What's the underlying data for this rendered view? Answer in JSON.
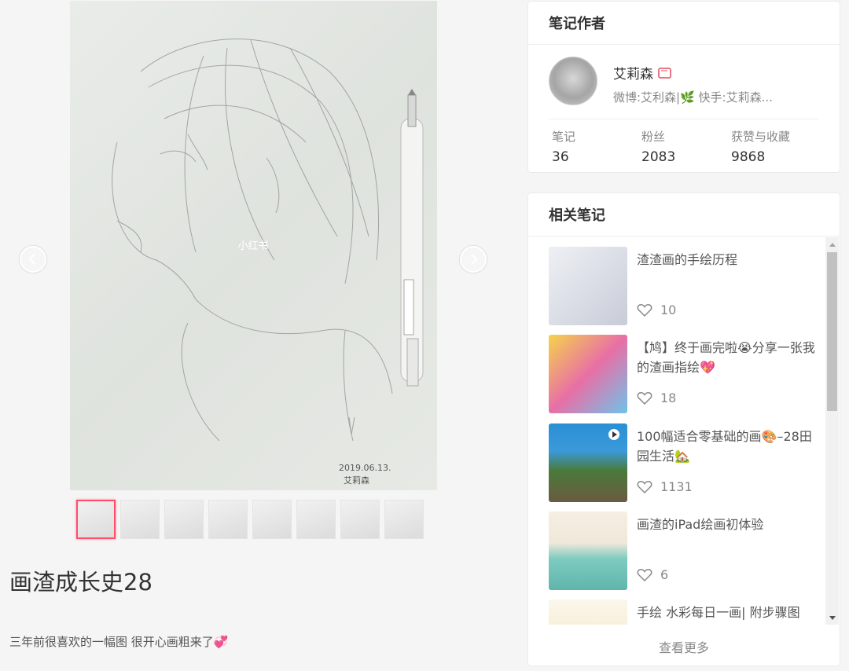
{
  "note": {
    "title": "画渣成长史28",
    "description": "三年前很喜欢的一幅图 很开心画粗来了💞",
    "image_watermark": "小红书",
    "image_date": "2019.06.13.",
    "image_signature": "艾莉森",
    "thumbnail_count": 8,
    "active_thumbnail": 1
  },
  "author_card": {
    "header": "笔记作者",
    "name": "艾莉森",
    "badge_icon": "red-book-badge-icon",
    "bio": "微博:艾利森|🌿 快手:艾莉森...",
    "stats": [
      {
        "label": "笔记",
        "value": "36"
      },
      {
        "label": "粉丝",
        "value": "2083"
      },
      {
        "label": "获赞与收藏",
        "value": "9868"
      }
    ]
  },
  "related_card": {
    "header": "相关笔记",
    "items": [
      {
        "title": "渣渣画的手绘历程",
        "likes": "10"
      },
      {
        "title": "【鸠】终于画完啦😭分享一张我的渣画指绘💖",
        "likes": "18"
      },
      {
        "title": "100幅适合零基础的画🎨–28田园生活🏡",
        "likes": "1131"
      },
      {
        "title": "画渣的iPad绘画初体验",
        "likes": "6"
      },
      {
        "title": "手绘 水彩每日一画| 附步骤图",
        "likes": ""
      }
    ],
    "more_label": "查看更多"
  },
  "colors": {
    "accent": "#ff4d6a",
    "text_primary": "#333333",
    "text_secondary": "#888888",
    "background": "#f5f5f5"
  }
}
